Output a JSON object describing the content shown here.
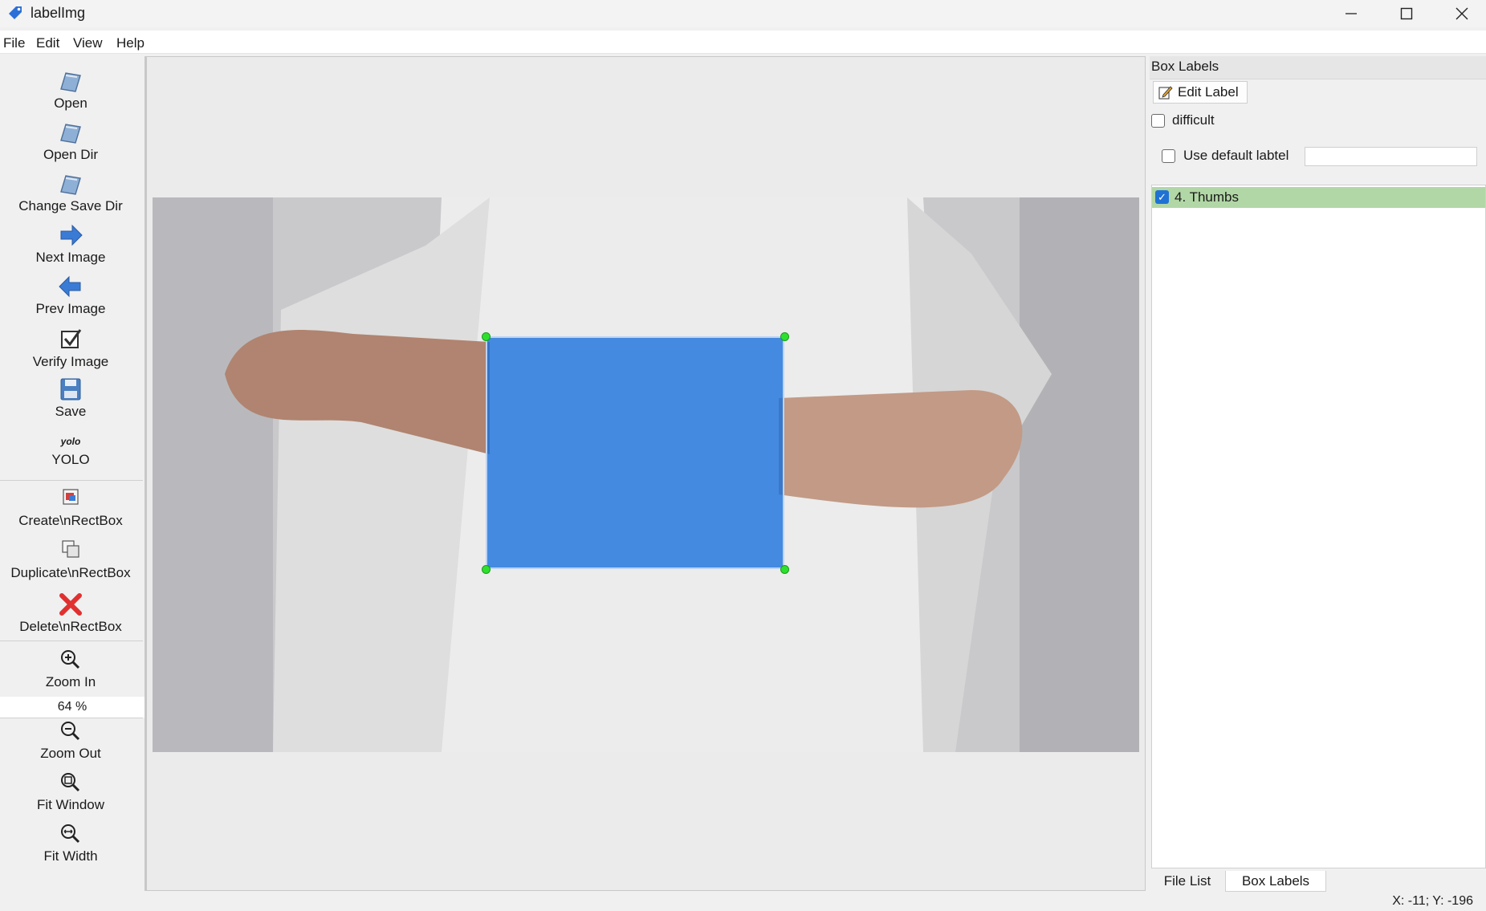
{
  "window": {
    "title": "labelImg",
    "minimize_icon": "minimize-icon",
    "maximize_icon": "maximize-icon",
    "close_icon": "close-icon"
  },
  "menu": {
    "file": "File",
    "edit": "Edit",
    "view": "View",
    "help": "Help"
  },
  "toolbar": {
    "open": "Open",
    "open_dir": "Open Dir",
    "change_save_dir": "Change Save Dir",
    "next_image": "Next Image",
    "prev_image": "Prev Image",
    "verify_image": "Verify Image",
    "save": "Save",
    "format_icon_text": "yolo",
    "format": "YOLO",
    "create_rect_box": "Create\\nRectBox",
    "duplicate_rect_box": "Duplicate\\nRectBox",
    "delete_rect_box": "Delete\\nRectBox",
    "zoom_in": "Zoom In",
    "zoom_level": "64 %",
    "zoom_out": "Zoom Out",
    "fit_window": "Fit Window",
    "fit_width": "Fit Width"
  },
  "panel": {
    "title": "Box Labels",
    "edit_label": "Edit Label",
    "difficult": "difficult",
    "use_default_label": "Use default labtel",
    "default_label_value": "",
    "labels": [
      {
        "text": "4. Thumbs",
        "checked": true
      }
    ]
  },
  "tabs": {
    "file_list": "File List",
    "box_labels": "Box Labels"
  },
  "status": {
    "coords": "X: -11; Y: -196"
  },
  "colors": {
    "box_fill": "#146edc",
    "label_highlight": "#b2d7a6",
    "handle": "#2ee02e"
  }
}
